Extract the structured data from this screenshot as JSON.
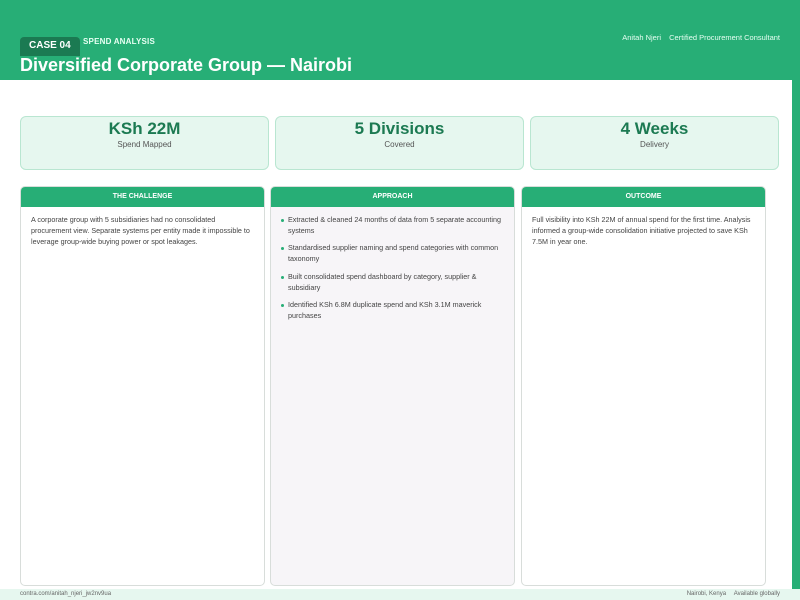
{
  "header": {
    "case_label": "CASE 04",
    "eyebrow": "SPEND ANALYSIS",
    "consultant_name": "Anitah Njeri",
    "consultant_title": "Certified Procurement Consultant",
    "title": "Diversified Corporate Group — Nairobi"
  },
  "stats": [
    {
      "value": "KSh 22M",
      "label": "Spend Mapped"
    },
    {
      "value": "5 Divisions",
      "label": "Covered"
    },
    {
      "value": "4 Weeks",
      "label": "Delivery"
    }
  ],
  "challenge": {
    "heading": "THE CHALLENGE",
    "text": "A corporate group with 5 subsidiaries had no consolidated procurement view. Separate systems per entity made it impossible to leverage group-wide buying power or spot leakages."
  },
  "approach": {
    "heading": "APPROACH",
    "items": [
      "Extracted & cleaned 24 months of data from 5 separate accounting systems",
      "Standardised supplier naming and spend categories with common taxonomy",
      "Built consolidated spend dashboard by category, supplier & subsidiary",
      "Identified KSh 6.8M duplicate spend and KSh 3.1M maverick purchases"
    ]
  },
  "outcome": {
    "heading": "OUTCOME",
    "text": "Full visibility into KSh 22M of annual spend for the first time. Analysis informed a group-wide consolidation initiative projected to save KSh 7.5M in year one."
  },
  "footer": {
    "link": "contra.com/anitah_njeri_jw2nv9ua",
    "location": "Nairobi, Kenya",
    "availability": "Available globally"
  },
  "colors": {
    "brand_green": "#27ae76",
    "dark_green": "#1b7a52",
    "stat_bg": "#e6f7ef"
  }
}
